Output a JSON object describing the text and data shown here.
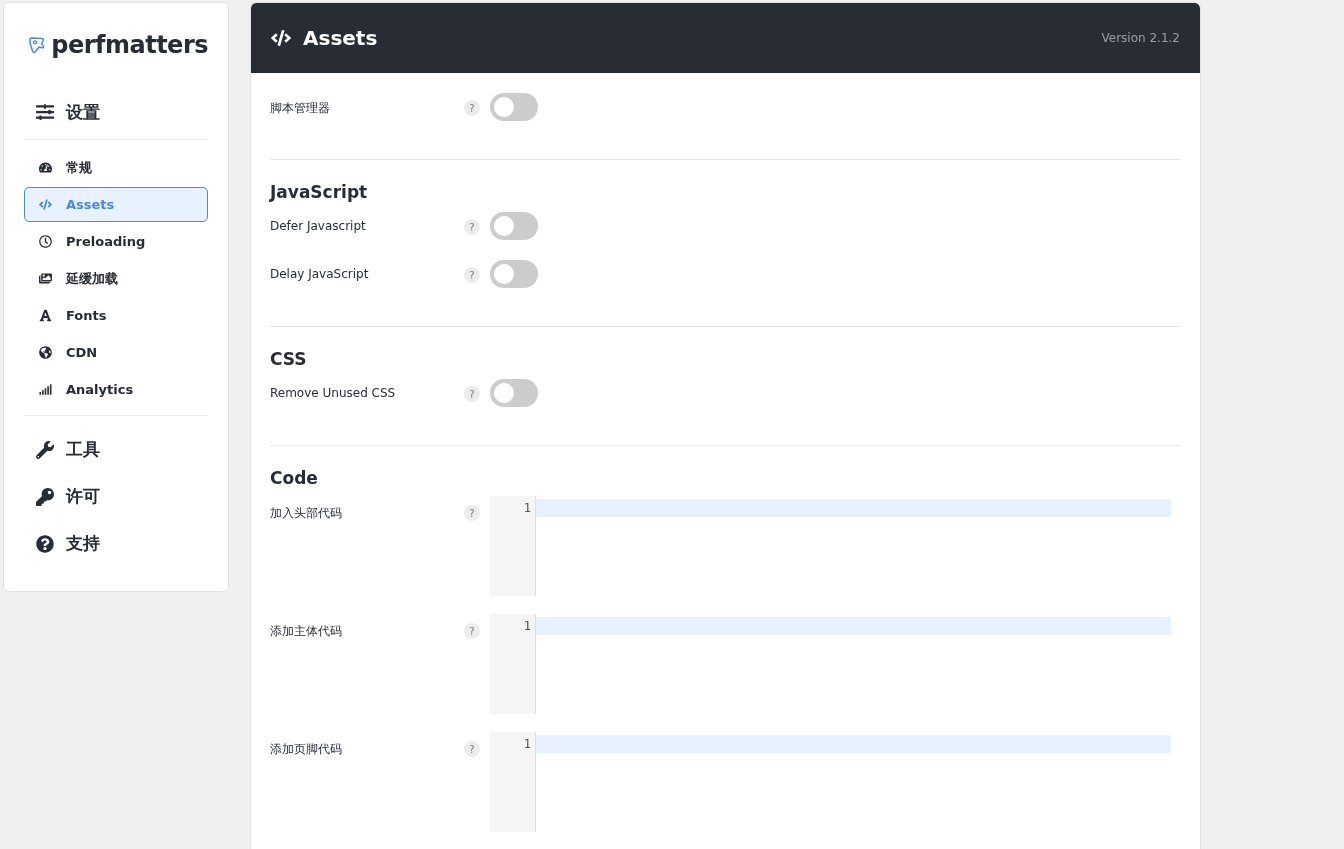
{
  "sidebar": {
    "logo": "perfmatters",
    "items": [
      {
        "kind": "section",
        "label": "设置"
      },
      {
        "kind": "subitem",
        "label": "常规",
        "selected": false
      },
      {
        "kind": "subitem",
        "label": "Assets",
        "selected": true
      },
      {
        "kind": "subitem",
        "label": "Preloading",
        "selected": false
      },
      {
        "kind": "subitem",
        "label": "延缓加载",
        "selected": false
      },
      {
        "kind": "subitem",
        "label": "Fonts",
        "selected": false
      },
      {
        "kind": "subitem",
        "label": "CDN",
        "selected": false
      },
      {
        "kind": "subitem",
        "label": "Analytics",
        "selected": false
      },
      {
        "kind": "section",
        "label": "工具"
      },
      {
        "kind": "section",
        "label": "许可"
      },
      {
        "kind": "section",
        "label": "支持"
      }
    ]
  },
  "header": {
    "title": "Assets",
    "version": "Version 2.1.2"
  },
  "sections": [
    {
      "rows": [
        {
          "kind": "toggle",
          "label": "脚本管理器",
          "help": "?",
          "on": false
        }
      ]
    },
    {
      "title": "JavaScript",
      "rows": [
        {
          "kind": "toggle",
          "label": "Defer Javascript",
          "help": "?",
          "on": false
        },
        {
          "kind": "toggle",
          "label": "Delay JavaScript",
          "help": "?",
          "on": false
        }
      ]
    },
    {
      "title": "CSS",
      "rows": [
        {
          "kind": "toggle",
          "label": "Remove Unused CSS",
          "help": "?",
          "on": false
        }
      ]
    },
    {
      "title": "Code",
      "rows": [
        {
          "kind": "code",
          "label": "加入头部代码",
          "help": "?",
          "line_number": "1"
        },
        {
          "kind": "code",
          "label": "添加主体代码",
          "help": "?",
          "line_number": "1"
        },
        {
          "kind": "code",
          "label": "添加页脚代码",
          "help": "?",
          "line_number": "1"
        }
      ]
    }
  ]
}
